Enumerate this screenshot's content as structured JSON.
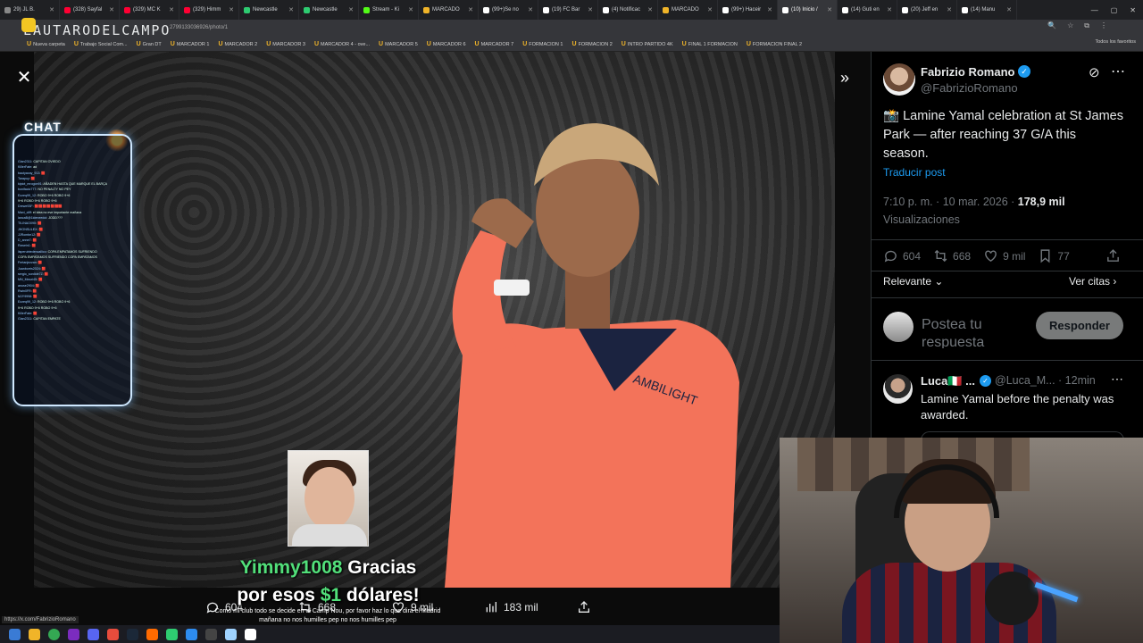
{
  "browser": {
    "tabs": [
      {
        "label": "29) JL B.",
        "color": "#888"
      },
      {
        "label": "(328) Sayfal",
        "color": "#ff0033"
      },
      {
        "label": "(329) MC K",
        "color": "#ff0033"
      },
      {
        "label": "(329) Himm",
        "color": "#ff0033"
      },
      {
        "label": "Newcastle",
        "color": "#2ecc71"
      },
      {
        "label": "Newcastle",
        "color": "#2ecc71"
      },
      {
        "label": "Stream - Ki",
        "color": "#53fc18"
      },
      {
        "label": "MARCADO",
        "color": "#f0b429"
      },
      {
        "label": "(99+)Se no",
        "color": "#fff"
      },
      {
        "label": "(19) FC Bar",
        "color": "#fff"
      },
      {
        "label": "(4) Notificac",
        "color": "#fff"
      },
      {
        "label": "MARCADO",
        "color": "#f0b429"
      },
      {
        "label": "(99+) Haceir",
        "color": "#fff"
      },
      {
        "label": "(10) Inicio /",
        "color": "#fff",
        "active": true
      },
      {
        "label": "(14) Guti en",
        "color": "#fff"
      },
      {
        "label": "(20) Jeff en",
        "color": "#fff"
      },
      {
        "label": "(14) Manu",
        "color": "#fff"
      }
    ],
    "url_fragment": "2799133036926/photo/1",
    "overlay_logo": "LAUTARODELCAMPO",
    "bookmarks": [
      "Nueva carpeta",
      "Trabajo Social Com...",
      "Gran DT",
      "MARCADOR 1",
      "MARCADOR 2",
      "MARCADOR 3",
      "MARCADOR 4 - ove...",
      "MARCADOR 5",
      "MARCADOR 6",
      "MARCADOR 7",
      "FORMACION 1",
      "FORMACION 2",
      "INTRO PARTIDO 4K",
      "FINAL 1 FORMACION",
      "FORMACION FINAL 2"
    ],
    "bookmarks_right": "Todos los favoritos",
    "status_url": "https://x.com/FabrizioRomano"
  },
  "tweet": {
    "author_name": "Fabrizio Romano",
    "author_handle": "@FabrizioRomano",
    "text": "📸 Lamine Yamal celebration at St James Park — after reaching 37 G/A this season.",
    "translate": "Traducir post",
    "time": "7:10 p. m. · 10 mar. 2026 · ",
    "views_count": "178,9 mil",
    "views_label": " Visualizaciones",
    "stats": {
      "replies": "604",
      "reposts": "668",
      "likes": "9 mil",
      "bookmarks": "77"
    },
    "sort": "Relevante",
    "quotes": "Ver citas",
    "reply_placeholder": "Postea tu respuesta",
    "reply_button": "Responder",
    "first_reply": {
      "name": "Luca🇮🇹 ...",
      "handle": "@Luca_M... · 12min",
      "text": "Lamine Yamal before the penalty was awarded."
    }
  },
  "viewer_bar": {
    "replies": "604",
    "reposts": "668",
    "likes": "9 mil",
    "views": "183 mil"
  },
  "stream_overlay": {
    "chat_title": "CHAT",
    "chat_lines": [
      {
        "user": "Gian2311",
        "msg": ": CAPITAN OVIEDO"
      },
      {
        "user": "KillerFate",
        "msg": ": ad"
      },
      {
        "user": "bautyaxay_913",
        "msg": ": 🟥"
      },
      {
        "user": "Tarapuy",
        "msg": ": 🟥"
      },
      {
        "user": "kipiot_mrogon91",
        "msg": ": AÑADEN HASTA QUE MARQUE EL BARÇA"
      },
      {
        "user": "bonifacio777",
        "msg": ": NO PENALTY NO PEY"
      },
      {
        "user": "Ezzeq99_12",
        "msg": ": ROBO 9+6 ROBO 9+6"
      },
      {
        "user": "",
        "msg": "9+6 ROBO 9+6 ROBO 9+6"
      },
      {
        "user": "Drewe93F",
        "msg": ": 🟥🟥🟥🟥🟥🟥🟥"
      },
      {
        "user": "Maxi_cliff",
        "msg": ": el idea no eve importante mañana"
      },
      {
        "user": "lancaB@1ldeneedol",
        "msg": ": JODD???"
      },
      {
        "user": "TILINAO090",
        "msg": ": 🟥"
      },
      {
        "user": "JHONSULEX",
        "msg": ": 🟥"
      },
      {
        "user": "JJRombe12",
        "msg": ": 🟥"
      },
      {
        "user": "D_anne7",
        "msg": ": 🟥"
      },
      {
        "user": "Rzwein1",
        "msg": ": 🟥"
      },
      {
        "user": "lisperubtedencallico",
        "msg": ": COPA EMPATAMOS SUFRIENDO"
      },
      {
        "user": "",
        "msg": "COPA EMPATAMOS SUFRIENDO COPA EMPATAMOS"
      },
      {
        "user": "Fertanjezzan",
        "msg": ": 🟥"
      },
      {
        "user": "Juanborris2024",
        "msg": ": 🟥"
      },
      {
        "user": "sergio_sordide7Z",
        "msg": ": 🟥"
      },
      {
        "user": "MN_Mezzi45",
        "msg": ": 🟥"
      },
      {
        "user": "anuse2904",
        "msg": ": 🟥"
      },
      {
        "user": "Rwin0FR",
        "msg": ": 🟥"
      },
      {
        "user": "MJY9998",
        "msg": ": 🟥"
      },
      {
        "user": "Ezzeq99_12",
        "msg": ": ROBO 9+6 ROBO 9+6"
      },
      {
        "user": "",
        "msg": "9+6 ROBO 9+6 ROBO 9+6"
      },
      {
        "user": "KillerFate",
        "msg": ": 🟥"
      },
      {
        "user": "Gian2311",
        "msg": ": CAPITAN EMPATE"
      }
    ],
    "donation_user": "Yimmy1008",
    "donation_pre": " Gracias",
    "donation_line2a": "por esos ",
    "donation_amount": "$1",
    "donation_line2b": " dólares!",
    "subtitle": "Como mi club todo se decide en el Camp Nou, por favor haz lo que dirá el Madrid mañana no nos humilles pep no nos humilles pep"
  }
}
